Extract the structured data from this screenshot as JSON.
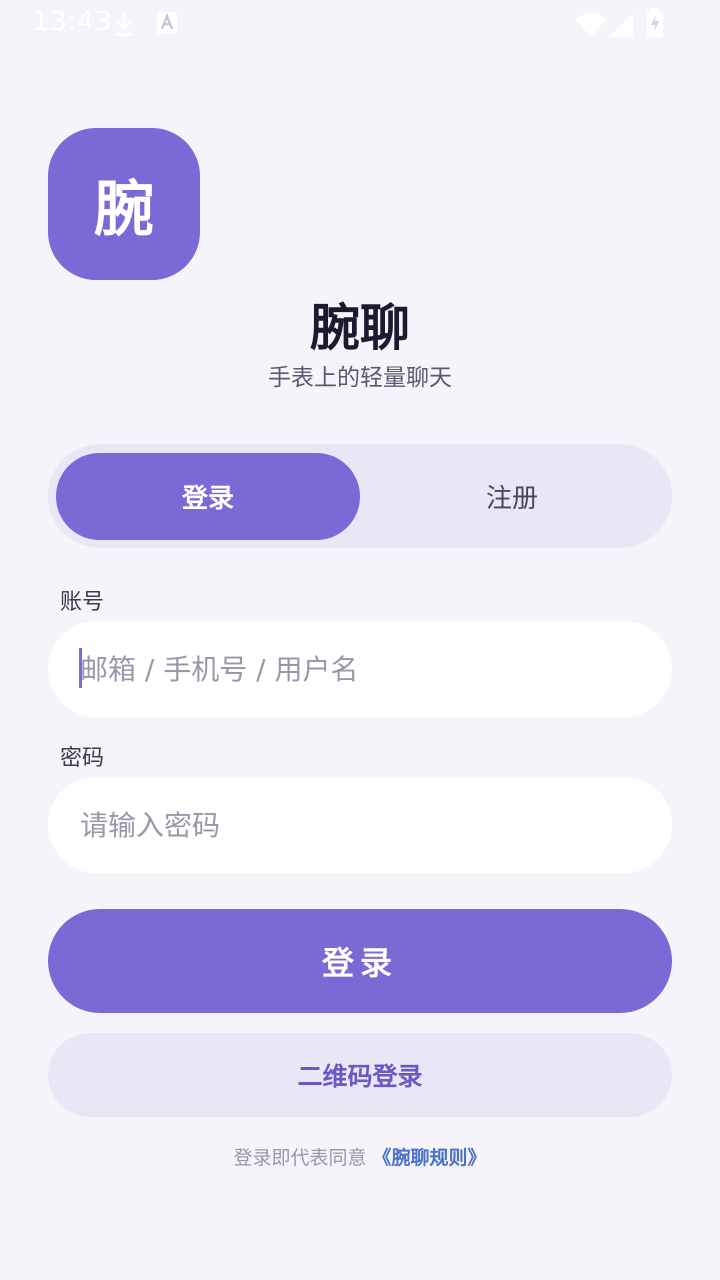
{
  "status_bar": {
    "time": "13:43",
    "icons": [
      "download-icon",
      "keyboard-a-icon",
      "wifi-icon",
      "cell-signal-icon",
      "battery-charging-icon"
    ]
  },
  "brand": {
    "logo_char": "腕",
    "name": "腕聊",
    "slogan": "手表上的轻量聊天",
    "accent_color": "#7b69d6"
  },
  "mode_tabs": {
    "login_label": "登录",
    "register_label": "注册",
    "selected": "login"
  },
  "form": {
    "account": {
      "label": "账号",
      "placeholder": "邮箱 / 手机号 / 用户名",
      "value": ""
    },
    "password": {
      "label": "密码",
      "placeholder": "请输入密码",
      "value": ""
    },
    "submit_label": "登录",
    "qr_login_label": "二维码登录"
  },
  "agreement": {
    "prefix": "登录即代表同意",
    "link_text": "《腕聊规则》",
    "link_color": "#4a72c8"
  }
}
